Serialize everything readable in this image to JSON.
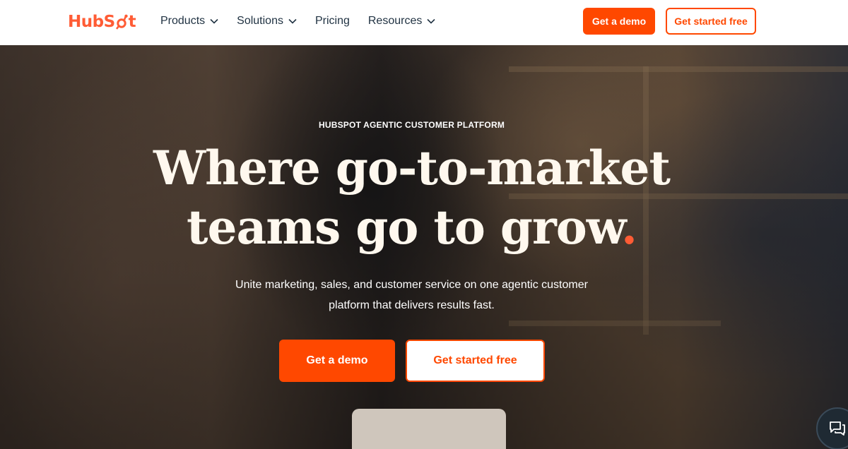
{
  "brand": {
    "name_part1": "HubS",
    "name_part2": "t",
    "accent": "#ff5c35"
  },
  "nav": {
    "items": [
      {
        "label": "Products",
        "has_dropdown": true
      },
      {
        "label": "Solutions",
        "has_dropdown": true
      },
      {
        "label": "Pricing",
        "has_dropdown": false
      },
      {
        "label": "Resources",
        "has_dropdown": true
      }
    ],
    "demo_label": "Get a demo",
    "free_label": "Get started free"
  },
  "hero": {
    "eyebrow": "HUBSPOT AGENTIC CUSTOMER PLATFORM",
    "headline_line1": "Where go-to-market",
    "headline_line2": "teams go to grow",
    "headline_dot": ".",
    "subtext": "Unite marketing, sales, and customer service on one agentic customer platform that delivers results fast.",
    "demo_label": "Get a demo",
    "free_label": "Get started free"
  },
  "colors": {
    "primary_button": "#ff4800",
    "text_dark": "#213343"
  },
  "icons": {
    "chat": "chat-bubbles-icon",
    "chevron": "chevron-down-icon",
    "logo": "sprocket-icon"
  }
}
